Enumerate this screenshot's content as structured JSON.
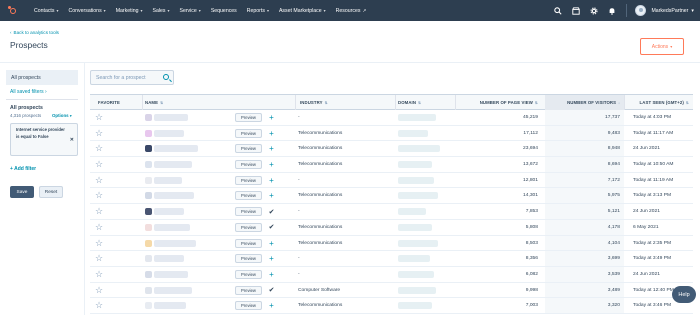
{
  "nav": {
    "items": [
      "Contacts",
      "Conversations",
      "Marketing",
      "Sales",
      "Service",
      "Sequences",
      "Reports",
      "Asset Marketplace",
      "Resources"
    ],
    "dropdowns": [
      true,
      true,
      true,
      true,
      true,
      false,
      true,
      true,
      false
    ],
    "account": "MarkedsPartner",
    "icons": [
      "search-icon",
      "marketplace-icon",
      "settings-icon",
      "notifications-icon"
    ]
  },
  "header": {
    "back_link": "Back to analytics tools",
    "title": "Prospects",
    "actions_label": "Actions"
  },
  "sidebar": {
    "all_prospects": "All prospects",
    "saved_filters": "All saved filters",
    "current_view": "All prospects",
    "count": "4,316 prospects",
    "options": "Options",
    "filter_text": "Internet service provider is equal to False",
    "add_filter": "Add filter",
    "save_label": "Save",
    "reset_label": "Reset"
  },
  "search": {
    "placeholder": "Search for a prospect"
  },
  "table": {
    "columns": [
      "FAVORITE",
      "NAME",
      "INDUSTRY",
      "DOMAIN",
      "NUMBER OF PAGE VIEW",
      "NUMBER OF VISITORS",
      "LAST SEEN (GMT+2)"
    ],
    "sorted_column": "NUMBER OF VISITORS",
    "preview_label": "Preview",
    "rows": [
      {
        "industry": "-",
        "page_views": "45,219",
        "visitors": "17,737",
        "last_seen": "Today at 4:03 PM",
        "following": false,
        "swatch": "#d9d4e8"
      },
      {
        "industry": "Telecommunications",
        "page_views": "17,112",
        "visitors": "9,483",
        "last_seen": "Today at 11:17 AM",
        "following": false,
        "swatch": "#e8c7ee"
      },
      {
        "industry": "Telecommunications",
        "page_views": "23,694",
        "visitors": "8,948",
        "last_seen": "24 Jun 2021",
        "following": false,
        "swatch": "#3a4868"
      },
      {
        "industry": "Telecommunications",
        "page_views": "13,672",
        "visitors": "8,694",
        "last_seen": "Today at 10:50 AM",
        "following": false,
        "swatch": "#dce3ee"
      },
      {
        "industry": "-",
        "page_views": "12,801",
        "visitors": "7,172",
        "last_seen": "Today at 11:19 AM",
        "following": false,
        "swatch": "#e9ebf0"
      },
      {
        "industry": "Telecommunications",
        "page_views": "14,301",
        "visitors": "5,975",
        "last_seen": "Today at 3:13 PM",
        "following": false,
        "swatch": "#d2d9e6"
      },
      {
        "industry": "-",
        "page_views": "7,853",
        "visitors": "5,121",
        "last_seen": "24 Jun 2021",
        "following": true,
        "swatch": "#4a5572"
      },
      {
        "industry": "Telecommunications",
        "page_views": "5,808",
        "visitors": "4,178",
        "last_seen": "6 May 2021",
        "following": true,
        "swatch": "#f2dede"
      },
      {
        "industry": "Telecommunications",
        "page_views": "8,503",
        "visitors": "4,104",
        "last_seen": "Today at 2:35 PM",
        "following": false,
        "swatch": "#f5d9a8"
      },
      {
        "industry": "-",
        "page_views": "8,356",
        "visitors": "3,699",
        "last_seen": "Today at 3:49 PM",
        "following": false,
        "swatch": "#e3e7ee"
      },
      {
        "industry": "-",
        "page_views": "6,082",
        "visitors": "3,539",
        "last_seen": "24 Jun 2021",
        "following": false,
        "swatch": "#d6dce8"
      },
      {
        "industry": "Computer Software",
        "page_views": "9,998",
        "visitors": "3,489",
        "last_seen": "Today at 12:40 PM",
        "following": true,
        "swatch": "#dfe4ec"
      },
      {
        "industry": "Telecommunications",
        "page_views": "7,003",
        "visitors": "3,320",
        "last_seen": "Today at 3:46 PM",
        "following": false,
        "swatch": "#e8ecf2"
      }
    ]
  },
  "help_label": "Help",
  "colors": {
    "nav_bg": "#2d3e50",
    "accent": "#ff7a59",
    "link": "#0091ae",
    "text": "#33475b"
  }
}
